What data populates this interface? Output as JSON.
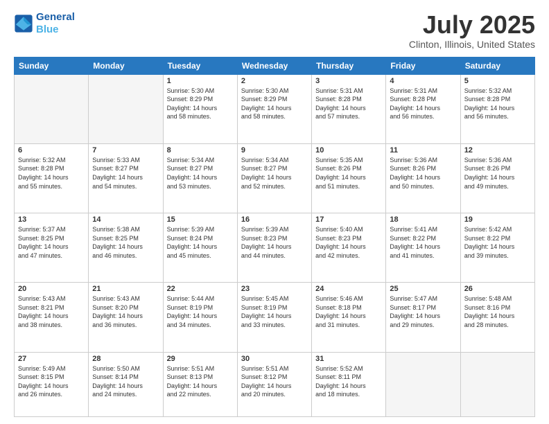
{
  "logo": {
    "line1": "General",
    "line2": "Blue"
  },
  "title": "July 2025",
  "subtitle": "Clinton, Illinois, United States",
  "days": [
    "Sunday",
    "Monday",
    "Tuesday",
    "Wednesday",
    "Thursday",
    "Friday",
    "Saturday"
  ],
  "weeks": [
    [
      {
        "num": "",
        "text": ""
      },
      {
        "num": "",
        "text": ""
      },
      {
        "num": "1",
        "text": "Sunrise: 5:30 AM\nSunset: 8:29 PM\nDaylight: 14 hours\nand 58 minutes."
      },
      {
        "num": "2",
        "text": "Sunrise: 5:30 AM\nSunset: 8:29 PM\nDaylight: 14 hours\nand 58 minutes."
      },
      {
        "num": "3",
        "text": "Sunrise: 5:31 AM\nSunset: 8:28 PM\nDaylight: 14 hours\nand 57 minutes."
      },
      {
        "num": "4",
        "text": "Sunrise: 5:31 AM\nSunset: 8:28 PM\nDaylight: 14 hours\nand 56 minutes."
      },
      {
        "num": "5",
        "text": "Sunrise: 5:32 AM\nSunset: 8:28 PM\nDaylight: 14 hours\nand 56 minutes."
      }
    ],
    [
      {
        "num": "6",
        "text": "Sunrise: 5:32 AM\nSunset: 8:28 PM\nDaylight: 14 hours\nand 55 minutes."
      },
      {
        "num": "7",
        "text": "Sunrise: 5:33 AM\nSunset: 8:27 PM\nDaylight: 14 hours\nand 54 minutes."
      },
      {
        "num": "8",
        "text": "Sunrise: 5:34 AM\nSunset: 8:27 PM\nDaylight: 14 hours\nand 53 minutes."
      },
      {
        "num": "9",
        "text": "Sunrise: 5:34 AM\nSunset: 8:27 PM\nDaylight: 14 hours\nand 52 minutes."
      },
      {
        "num": "10",
        "text": "Sunrise: 5:35 AM\nSunset: 8:26 PM\nDaylight: 14 hours\nand 51 minutes."
      },
      {
        "num": "11",
        "text": "Sunrise: 5:36 AM\nSunset: 8:26 PM\nDaylight: 14 hours\nand 50 minutes."
      },
      {
        "num": "12",
        "text": "Sunrise: 5:36 AM\nSunset: 8:26 PM\nDaylight: 14 hours\nand 49 minutes."
      }
    ],
    [
      {
        "num": "13",
        "text": "Sunrise: 5:37 AM\nSunset: 8:25 PM\nDaylight: 14 hours\nand 47 minutes."
      },
      {
        "num": "14",
        "text": "Sunrise: 5:38 AM\nSunset: 8:25 PM\nDaylight: 14 hours\nand 46 minutes."
      },
      {
        "num": "15",
        "text": "Sunrise: 5:39 AM\nSunset: 8:24 PM\nDaylight: 14 hours\nand 45 minutes."
      },
      {
        "num": "16",
        "text": "Sunrise: 5:39 AM\nSunset: 8:23 PM\nDaylight: 14 hours\nand 44 minutes."
      },
      {
        "num": "17",
        "text": "Sunrise: 5:40 AM\nSunset: 8:23 PM\nDaylight: 14 hours\nand 42 minutes."
      },
      {
        "num": "18",
        "text": "Sunrise: 5:41 AM\nSunset: 8:22 PM\nDaylight: 14 hours\nand 41 minutes."
      },
      {
        "num": "19",
        "text": "Sunrise: 5:42 AM\nSunset: 8:22 PM\nDaylight: 14 hours\nand 39 minutes."
      }
    ],
    [
      {
        "num": "20",
        "text": "Sunrise: 5:43 AM\nSunset: 8:21 PM\nDaylight: 14 hours\nand 38 minutes."
      },
      {
        "num": "21",
        "text": "Sunrise: 5:43 AM\nSunset: 8:20 PM\nDaylight: 14 hours\nand 36 minutes."
      },
      {
        "num": "22",
        "text": "Sunrise: 5:44 AM\nSunset: 8:19 PM\nDaylight: 14 hours\nand 34 minutes."
      },
      {
        "num": "23",
        "text": "Sunrise: 5:45 AM\nSunset: 8:19 PM\nDaylight: 14 hours\nand 33 minutes."
      },
      {
        "num": "24",
        "text": "Sunrise: 5:46 AM\nSunset: 8:18 PM\nDaylight: 14 hours\nand 31 minutes."
      },
      {
        "num": "25",
        "text": "Sunrise: 5:47 AM\nSunset: 8:17 PM\nDaylight: 14 hours\nand 29 minutes."
      },
      {
        "num": "26",
        "text": "Sunrise: 5:48 AM\nSunset: 8:16 PM\nDaylight: 14 hours\nand 28 minutes."
      }
    ],
    [
      {
        "num": "27",
        "text": "Sunrise: 5:49 AM\nSunset: 8:15 PM\nDaylight: 14 hours\nand 26 minutes."
      },
      {
        "num": "28",
        "text": "Sunrise: 5:50 AM\nSunset: 8:14 PM\nDaylight: 14 hours\nand 24 minutes."
      },
      {
        "num": "29",
        "text": "Sunrise: 5:51 AM\nSunset: 8:13 PM\nDaylight: 14 hours\nand 22 minutes."
      },
      {
        "num": "30",
        "text": "Sunrise: 5:51 AM\nSunset: 8:12 PM\nDaylight: 14 hours\nand 20 minutes."
      },
      {
        "num": "31",
        "text": "Sunrise: 5:52 AM\nSunset: 8:11 PM\nDaylight: 14 hours\nand 18 minutes."
      },
      {
        "num": "",
        "text": ""
      },
      {
        "num": "",
        "text": ""
      }
    ]
  ]
}
